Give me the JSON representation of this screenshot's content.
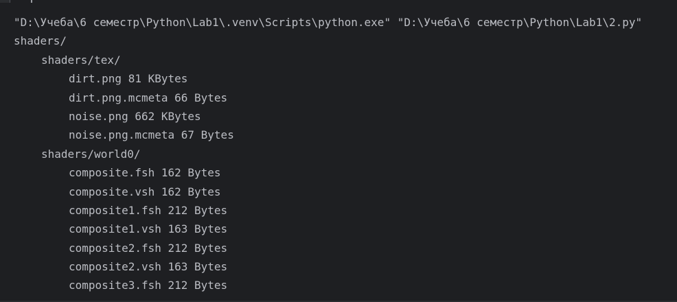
{
  "console": {
    "command": "\"D:\\Учеба\\6 семестр\\Python\\Lab1\\.venv\\Scripts\\python.exe\" \"D:\\Учеба\\6 семестр\\Python\\Lab1\\2.py\"",
    "lines": [
      {
        "text": "shaders/",
        "level": 0
      },
      {
        "text": "shaders/tex/",
        "level": 1
      },
      {
        "text": "dirt.png 81 KBytes",
        "level": 2
      },
      {
        "text": "dirt.png.mcmeta 66 Bytes",
        "level": 2
      },
      {
        "text": "noise.png 662 KBytes",
        "level": 2
      },
      {
        "text": "noise.png.mcmeta 67 Bytes",
        "level": 2
      },
      {
        "text": "shaders/world0/",
        "level": 1
      },
      {
        "text": "composite.fsh 162 Bytes",
        "level": 2
      },
      {
        "text": "composite.vsh 162 Bytes",
        "level": 2
      },
      {
        "text": "composite1.fsh 212 Bytes",
        "level": 2
      },
      {
        "text": "composite1.vsh 163 Bytes",
        "level": 2
      },
      {
        "text": "composite2.fsh 212 Bytes",
        "level": 2
      },
      {
        "text": "composite2.vsh 163 Bytes",
        "level": 2
      },
      {
        "text": "composite3.fsh 212 Bytes",
        "level": 2
      }
    ]
  },
  "colors": {
    "background": "#1e1f22",
    "text": "#bcbec4"
  }
}
